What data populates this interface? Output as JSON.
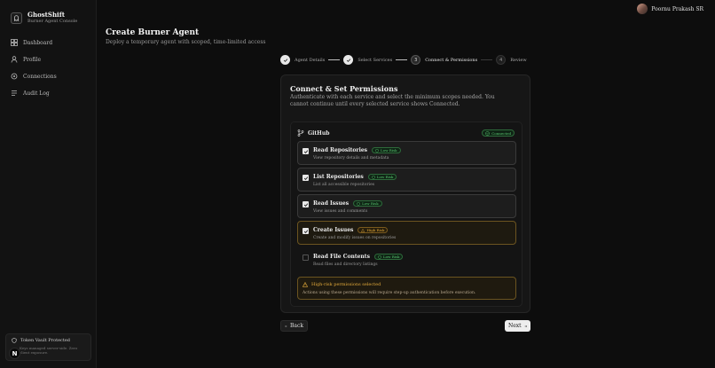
{
  "app": {
    "title": "GhostShift",
    "subtitle": "Burner Agent Console"
  },
  "sidebar": {
    "items": [
      {
        "label": "Dashboard",
        "icon": "grid-icon"
      },
      {
        "label": "Profile",
        "icon": "user-icon"
      },
      {
        "label": "Connections",
        "icon": "plug-icon"
      },
      {
        "label": "Audit Log",
        "icon": "log-icon"
      }
    ],
    "token": {
      "title": "Token Vault Protected",
      "desc": "Keys managed server-side. Zero client exposure."
    },
    "avatar_letter": "N"
  },
  "user": {
    "name": "Poornu Prakash SR"
  },
  "page": {
    "title": "Create Burner Agent",
    "subtitle": "Deploy a temporary agent with scoped, time-limited access"
  },
  "stepper": {
    "steps": [
      {
        "num": "1",
        "label": "Agent Details",
        "state": "done"
      },
      {
        "num": "2",
        "label": "Select Services",
        "state": "done"
      },
      {
        "num": "3",
        "label": "Connect & Permissions",
        "state": "active"
      },
      {
        "num": "4",
        "label": "Review",
        "state": "todo"
      }
    ]
  },
  "card": {
    "title": "Connect & Set Permissions",
    "desc": "Authenticate with each service and select the minimum scopes needed. You cannot continue until every selected service shows Connected."
  },
  "service": {
    "name": "GitHub",
    "status": "Connected",
    "permissions": [
      {
        "name": "Read Repositories",
        "desc": "View repository details and metadata",
        "risk": "Low Risk",
        "level": "low",
        "checked": true
      },
      {
        "name": "List Repositories",
        "desc": "List all accessible repositories",
        "risk": "Low Risk",
        "level": "low",
        "checked": true
      },
      {
        "name": "Read Issues",
        "desc": "View issues and comments",
        "risk": "Low Risk",
        "level": "low",
        "checked": true
      },
      {
        "name": "Create Issues",
        "desc": "Create and modify issues on repositories",
        "risk": "High Risk",
        "level": "high",
        "checked": true
      },
      {
        "name": "Read File Contents",
        "desc": "Read files and directory listings",
        "risk": "Low Risk",
        "level": "low",
        "checked": false
      }
    ]
  },
  "warning": {
    "title": "High-risk permissions selected",
    "desc": "Actions using these permissions will require step-up authentication before execution."
  },
  "buttons": {
    "back": "Back",
    "next": "Next"
  },
  "colors": {
    "connected": "#58c46f",
    "high_risk": "#e0a83a",
    "background": "#0d0d0d"
  }
}
